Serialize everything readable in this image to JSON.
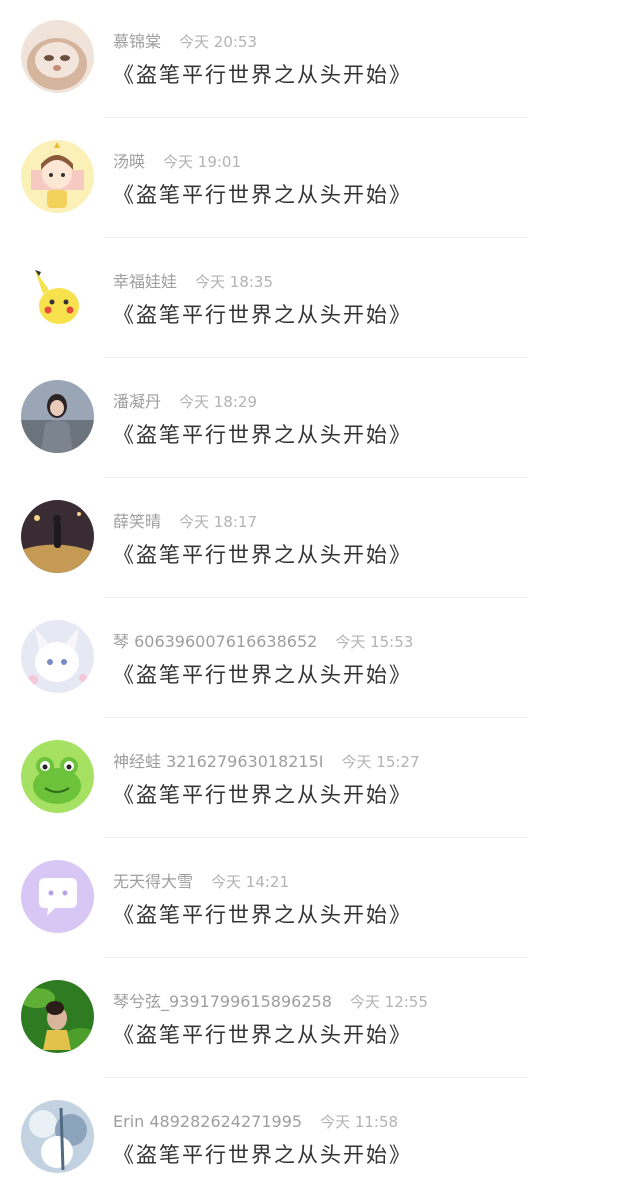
{
  "items": [
    {
      "name": "慕锦棠",
      "time": "今天 20:53",
      "title": "《盗笔平行世界之从头开始》",
      "avatar": "cat-photo-avatar",
      "colors": [
        "#f1e6de",
        "#c9a58c"
      ]
    },
    {
      "name": "汤暎",
      "time": "今天 19:01",
      "title": "《盗笔平行世界之从头开始》",
      "avatar": "cartoon-boy-avatar",
      "colors": [
        "#fbf2b5",
        "#f3c8b9"
      ]
    },
    {
      "name": "幸福娃娃",
      "time": "今天 18:35",
      "title": "《盗笔平行世界之从头开始》",
      "avatar": "pikachu-avatar",
      "colors": [
        "#ffffff",
        "#f6e24e"
      ]
    },
    {
      "name": "潘凝丹",
      "time": "今天 18:29",
      "title": "《盗笔平行世界之从头开始》",
      "avatar": "girl-photo-avatar",
      "colors": [
        "#8a96a8",
        "#565d66"
      ]
    },
    {
      "name": "薛笑晴",
      "time": "今天 18:17",
      "title": "《盗笔平行世界之从头开始》",
      "avatar": "night-street-avatar",
      "colors": [
        "#3d3035",
        "#c7a15a"
      ]
    },
    {
      "name": "琴 606396007616638652",
      "time": "今天 15:53",
      "title": "《盗笔平行世界之从头开始》",
      "avatar": "white-fox-avatar",
      "colors": [
        "#e9eaf5",
        "#c8cbe6"
      ]
    },
    {
      "name": "神经蛙 321627963018215I",
      "time": "今天 15:27",
      "title": "《盗笔平行世界之从头开始》",
      "avatar": "frog-avatar",
      "colors": [
        "#9be05a",
        "#4ea828"
      ]
    },
    {
      "name": "无天得大雪",
      "time": "今天 14:21",
      "title": "《盗笔平行世界之从头开始》",
      "avatar": "chat-bubble-avatar",
      "colors": [
        "#d9c8f5",
        "#ffffff"
      ]
    },
    {
      "name": "琴兮弦_939179961589625​8",
      "time": "今天 12:55",
      "title": "《盗笔平行世界之从头开始》",
      "avatar": "green-leaf-photo-avatar",
      "colors": [
        "#2e7d1f",
        "#7fc34a"
      ]
    },
    {
      "name": "Erin 489282624271995",
      "time": "今天 11:58",
      "title": "《盗笔平行世界之从头开始》",
      "avatar": "snow-tree-avatar",
      "colors": [
        "#b9c9d8",
        "#6f8aa3"
      ]
    }
  ]
}
